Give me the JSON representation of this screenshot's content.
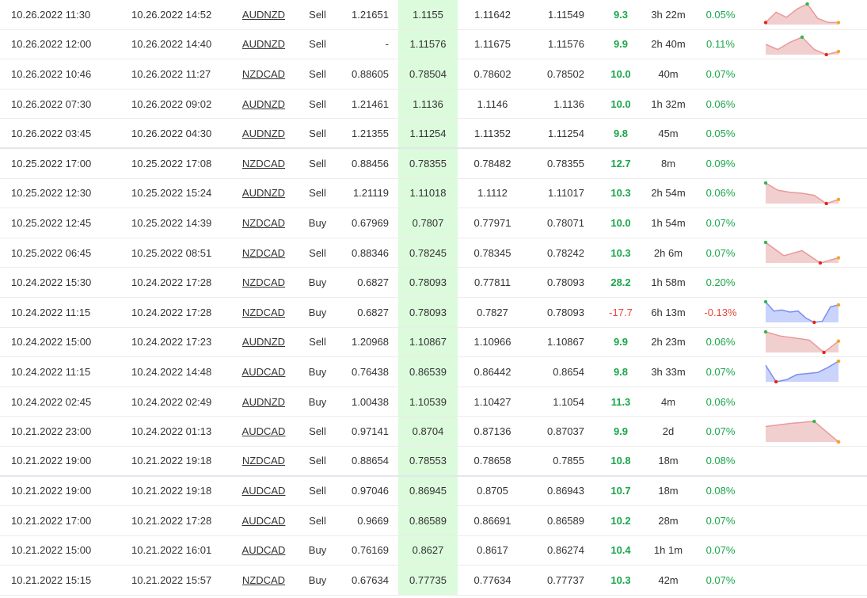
{
  "trades": [
    {
      "open": "10.26.2022 11:30",
      "close": "10.26.2022 14:52",
      "symbol": "AUDNZD",
      "type": "Sell",
      "open_price": "1.21651",
      "close_price": "1.1155",
      "sl": "1.11642",
      "tp": "1.11549",
      "pips": "9.3",
      "duration": "3h 22m",
      "pct": "0.05%",
      "trend": "up",
      "spark": {
        "values": [
          0.1,
          0.6,
          0.35,
          0.75,
          1.0,
          0.3,
          0.1,
          0.1
        ],
        "fill": "red"
      }
    },
    {
      "open": "10.26.2022 12:00",
      "close": "10.26.2022 14:40",
      "symbol": "AUDNZD",
      "type": "Sell",
      "open_price": "-",
      "close_price": "1.11576",
      "sl": "1.11675",
      "tp": "1.11576",
      "pips": "9.9",
      "duration": "2h 40m",
      "pct": "0.11%",
      "trend": "up",
      "spark": {
        "values": [
          0.5,
          0.25,
          0.6,
          0.85,
          0.25,
          0.0,
          0.15
        ],
        "fill": "red"
      }
    },
    {
      "open": "10.26.2022 10:46",
      "close": "10.26.2022 11:27",
      "symbol": "NZDCAD",
      "type": "Sell",
      "open_price": "0.88605",
      "close_price": "0.78504",
      "sl": "0.78602",
      "tp": "0.78502",
      "pips": "10.0",
      "duration": "40m",
      "pct": "0.07%",
      "trend": "up",
      "spark": null
    },
    {
      "open": "10.26.2022 07:30",
      "close": "10.26.2022 09:02",
      "symbol": "AUDNZD",
      "type": "Sell",
      "open_price": "1.21461",
      "close_price": "1.1136",
      "sl": "1.1146",
      "tp": "1.1136",
      "pips": "10.0",
      "duration": "1h 32m",
      "pct": "0.06%",
      "trend": "up",
      "spark": null
    },
    {
      "open": "10.26.2022 03:45",
      "close": "10.26.2022 04:30",
      "symbol": "AUDNZD",
      "type": "Sell",
      "open_price": "1.21355",
      "close_price": "1.11254",
      "sl": "1.11352",
      "tp": "1.11254",
      "pips": "9.8",
      "duration": "45m",
      "pct": "0.05%",
      "trend": "up",
      "spark": null
    },
    {
      "open": "10.25.2022 17:00",
      "close": "10.25.2022 17:08",
      "symbol": "NZDCAD",
      "type": "Sell",
      "open_price": "0.88456",
      "close_price": "0.78355",
      "sl": "0.78482",
      "tp": "0.78355",
      "pips": "12.7",
      "duration": "8m",
      "pct": "0.09%",
      "trend": "up",
      "spark": null
    },
    {
      "open": "10.25.2022 12:30",
      "close": "10.25.2022 15:24",
      "symbol": "AUDNZD",
      "type": "Sell",
      "open_price": "1.21119",
      "close_price": "1.11018",
      "sl": "1.1112",
      "tp": "1.11017",
      "pips": "10.3",
      "duration": "2h 54m",
      "pct": "0.06%",
      "trend": "up",
      "spark": {
        "values": [
          1.0,
          0.65,
          0.55,
          0.5,
          0.4,
          0.0,
          0.2
        ],
        "fill": "red"
      }
    },
    {
      "open": "10.25.2022 12:45",
      "close": "10.25.2022 14:39",
      "symbol": "NZDCAD",
      "type": "Buy",
      "open_price": "0.67969",
      "close_price": "0.7807",
      "sl": "0.77971",
      "tp": "0.78071",
      "pips": "10.0",
      "duration": "1h 54m",
      "pct": "0.07%",
      "trend": "up",
      "spark": null
    },
    {
      "open": "10.25.2022 06:45",
      "close": "10.25.2022 08:51",
      "symbol": "NZDCAD",
      "type": "Sell",
      "open_price": "0.88346",
      "close_price": "0.78245",
      "sl": "0.78345",
      "tp": "0.78242",
      "pips": "10.3",
      "duration": "2h 6m",
      "pct": "0.07%",
      "trend": "up",
      "spark": {
        "values": [
          1.0,
          0.35,
          0.6,
          0.0,
          0.25
        ],
        "fill": "red"
      }
    },
    {
      "open": "10.24.2022 15:30",
      "close": "10.24.2022 17:28",
      "symbol": "NZDCAD",
      "type": "Buy",
      "open_price": "0.6827",
      "close_price": "0.78093",
      "sl": "0.77811",
      "tp": "0.78093",
      "pips": "28.2",
      "duration": "1h 58m",
      "pct": "0.20%",
      "trend": "up",
      "spark": null
    },
    {
      "open": "10.24.2022 11:15",
      "close": "10.24.2022 17:28",
      "symbol": "NZDCAD",
      "type": "Buy",
      "open_price": "0.6827",
      "close_price": "0.78093",
      "sl": "0.7827",
      "tp": "0.78093",
      "pips": "-17.7",
      "duration": "6h 13m",
      "pct": "-0.13%",
      "trend": "down",
      "spark": {
        "values": [
          1.0,
          0.55,
          0.6,
          0.5,
          0.55,
          0.2,
          0.0,
          0.05,
          0.75,
          0.85
        ],
        "fill": "blue"
      }
    },
    {
      "open": "10.24.2022 15:00",
      "close": "10.24.2022 17:23",
      "symbol": "AUDNZD",
      "type": "Sell",
      "open_price": "1.20968",
      "close_price": "1.10867",
      "sl": "1.10966",
      "tp": "1.10867",
      "pips": "9.9",
      "duration": "2h 23m",
      "pct": "0.06%",
      "trend": "up",
      "spark": {
        "values": [
          1.0,
          0.8,
          0.7,
          0.6,
          0.0,
          0.55
        ],
        "fill": "red"
      }
    },
    {
      "open": "10.24.2022 11:15",
      "close": "10.24.2022 14:48",
      "symbol": "AUDCAD",
      "type": "Buy",
      "open_price": "0.76438",
      "close_price": "0.86539",
      "sl": "0.86442",
      "tp": "0.8654",
      "pips": "9.8",
      "duration": "3h 33m",
      "pct": "0.07%",
      "trend": "up",
      "spark": {
        "values": [
          0.8,
          0.0,
          0.1,
          0.35,
          0.4,
          0.45,
          0.7,
          1.0
        ],
        "fill": "blue"
      }
    },
    {
      "open": "10.24.2022 02:45",
      "close": "10.24.2022 02:49",
      "symbol": "AUDNZD",
      "type": "Buy",
      "open_price": "1.00438",
      "close_price": "1.10539",
      "sl": "1.10427",
      "tp": "1.1054",
      "pips": "11.3",
      "duration": "4m",
      "pct": "0.06%",
      "trend": "up",
      "spark": null
    },
    {
      "open": "10.21.2022 23:00",
      "close": "10.24.2022 01:13",
      "symbol": "AUDCAD",
      "type": "Sell",
      "open_price": "0.97141",
      "close_price": "0.8704",
      "sl": "0.87136",
      "tp": "0.87037",
      "pips": "9.9",
      "duration": "2d",
      "pct": "0.07%",
      "trend": "up",
      "spark": {
        "values": [
          0.75,
          0.9,
          1.0,
          0.0
        ],
        "fill": "red"
      }
    },
    {
      "open": "10.21.2022 19:00",
      "close": "10.21.2022 19:18",
      "symbol": "NZDCAD",
      "type": "Sell",
      "open_price": "0.88654",
      "close_price": "0.78553",
      "sl": "0.78658",
      "tp": "0.7855",
      "pips": "10.8",
      "duration": "18m",
      "pct": "0.08%",
      "trend": "up",
      "spark": null
    },
    {
      "open": "10.21.2022 19:00",
      "close": "10.21.2022 19:18",
      "symbol": "AUDCAD",
      "type": "Sell",
      "open_price": "0.97046",
      "close_price": "0.86945",
      "sl": "0.8705",
      "tp": "0.86943",
      "pips": "10.7",
      "duration": "18m",
      "pct": "0.08%",
      "trend": "up",
      "spark": null
    },
    {
      "open": "10.21.2022 17:00",
      "close": "10.21.2022 17:28",
      "symbol": "AUDCAD",
      "type": "Sell",
      "open_price": "0.9669",
      "close_price": "0.86589",
      "sl": "0.86691",
      "tp": "0.86589",
      "pips": "10.2",
      "duration": "28m",
      "pct": "0.07%",
      "trend": "up",
      "spark": null
    },
    {
      "open": "10.21.2022 15:00",
      "close": "10.21.2022 16:01",
      "symbol": "AUDCAD",
      "type": "Buy",
      "open_price": "0.76169",
      "close_price": "0.8627",
      "sl": "0.8617",
      "tp": "0.86274",
      "pips": "10.4",
      "duration": "1h 1m",
      "pct": "0.07%",
      "trend": "up",
      "spark": null
    },
    {
      "open": "10.21.2022 15:15",
      "close": "10.21.2022 15:57",
      "symbol": "NZDCAD",
      "type": "Buy",
      "open_price": "0.67634",
      "close_price": "0.77735",
      "sl": "0.77634",
      "tp": "0.77737",
      "pips": "10.3",
      "duration": "42m",
      "pct": "0.07%",
      "trend": "up",
      "spark": null
    }
  ],
  "colors": {
    "positive": "#1aa64a",
    "negative": "#e8473a",
    "close_price_bg": "#dcfadc",
    "spark_red_line": "#e99a9a",
    "spark_red_fill": "#f2cfcf",
    "spark_blue_line": "#7b8ff0",
    "spark_blue_fill": "#c9d3fb",
    "spark_start": "#2fb84a",
    "spark_min": "#e8231a",
    "spark_end": "#f5a623"
  }
}
